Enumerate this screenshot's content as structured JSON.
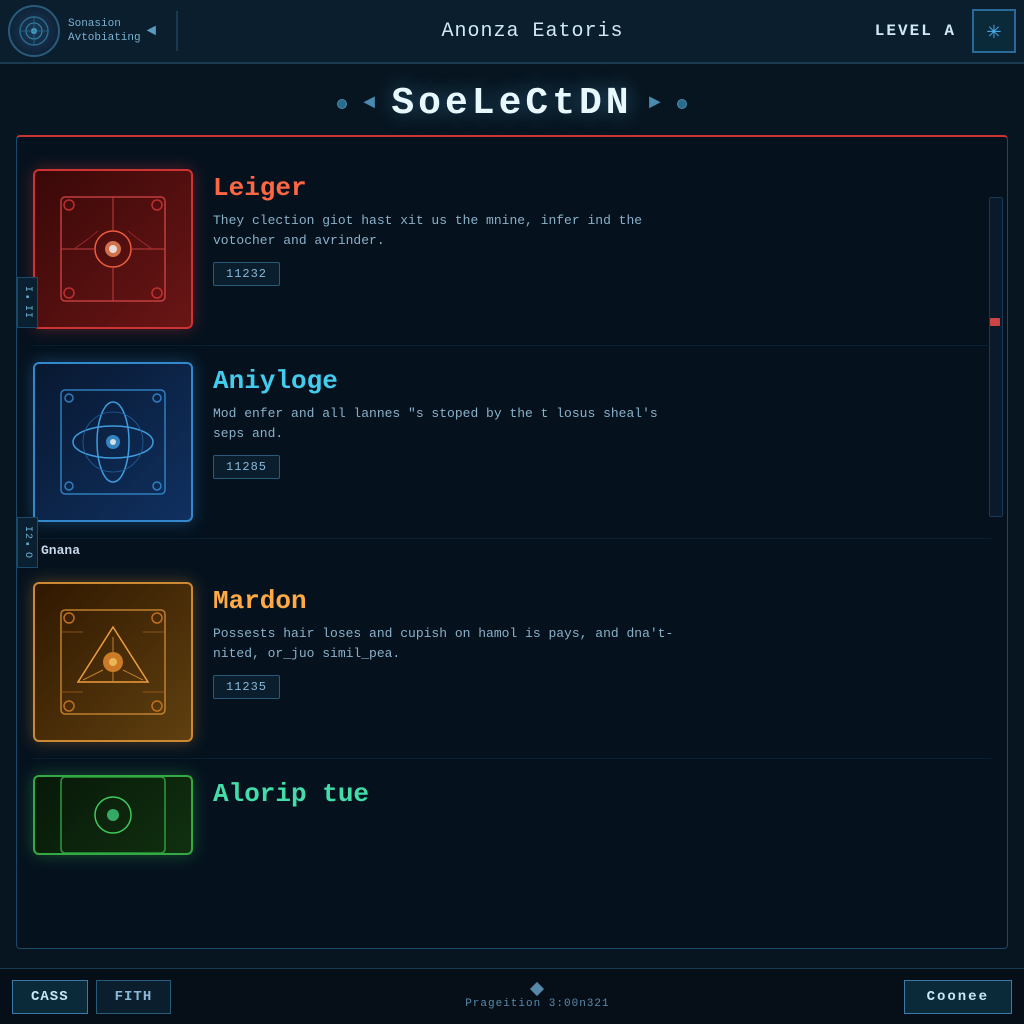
{
  "topbar": {
    "logo_alt": "logo",
    "nav_line1": "Sonasion",
    "nav_line2": "Avtobiating",
    "nav_arrow": "◄",
    "title": "Anonza Eatoris",
    "level": "LEVEL A",
    "asterisk": "✳"
  },
  "selection": {
    "title": "SoeLeCtDN",
    "decorator_left_arrow": "◄",
    "decorator_right_arrow": "►"
  },
  "items": [
    {
      "id": "item-1",
      "name": "Leiger",
      "name_class": "item-name-red",
      "card_class": "item-card-red",
      "color": "red",
      "desc": "They clection giot hast xit us the mnine, infer ind the votocher and avrinder.",
      "badge": "11232"
    },
    {
      "id": "item-2",
      "name": "Aniyloge",
      "name_class": "item-name-blue",
      "card_class": "item-card-blue",
      "color": "blue",
      "desc": "Mod enfer and all lannes \"s stoped by the t losus sheal's seps and.",
      "badge": "11285"
    },
    {
      "id": "item-3",
      "name": "Mardon",
      "name_class": "item-name-orange",
      "card_class": "item-card-orange",
      "color": "orange",
      "desc": "Possests hair loses and cupish on hamol is pays, and dna't-nited, or_juo simil_pea.",
      "badge": "11235"
    },
    {
      "id": "item-4",
      "name": "Alorip tue",
      "name_class": "item-name-green",
      "card_class": "item-card-green",
      "color": "green",
      "desc": "",
      "badge": ""
    }
  ],
  "side_tags": {
    "tag1": "I▪II",
    "tag2": "I2▪O"
  },
  "section_label": "Gnana",
  "bottom": {
    "btn_cass": "CASS",
    "btn_fith": "FITH",
    "status": "Prageition 3:00n321",
    "btn_right": "Coonee"
  }
}
